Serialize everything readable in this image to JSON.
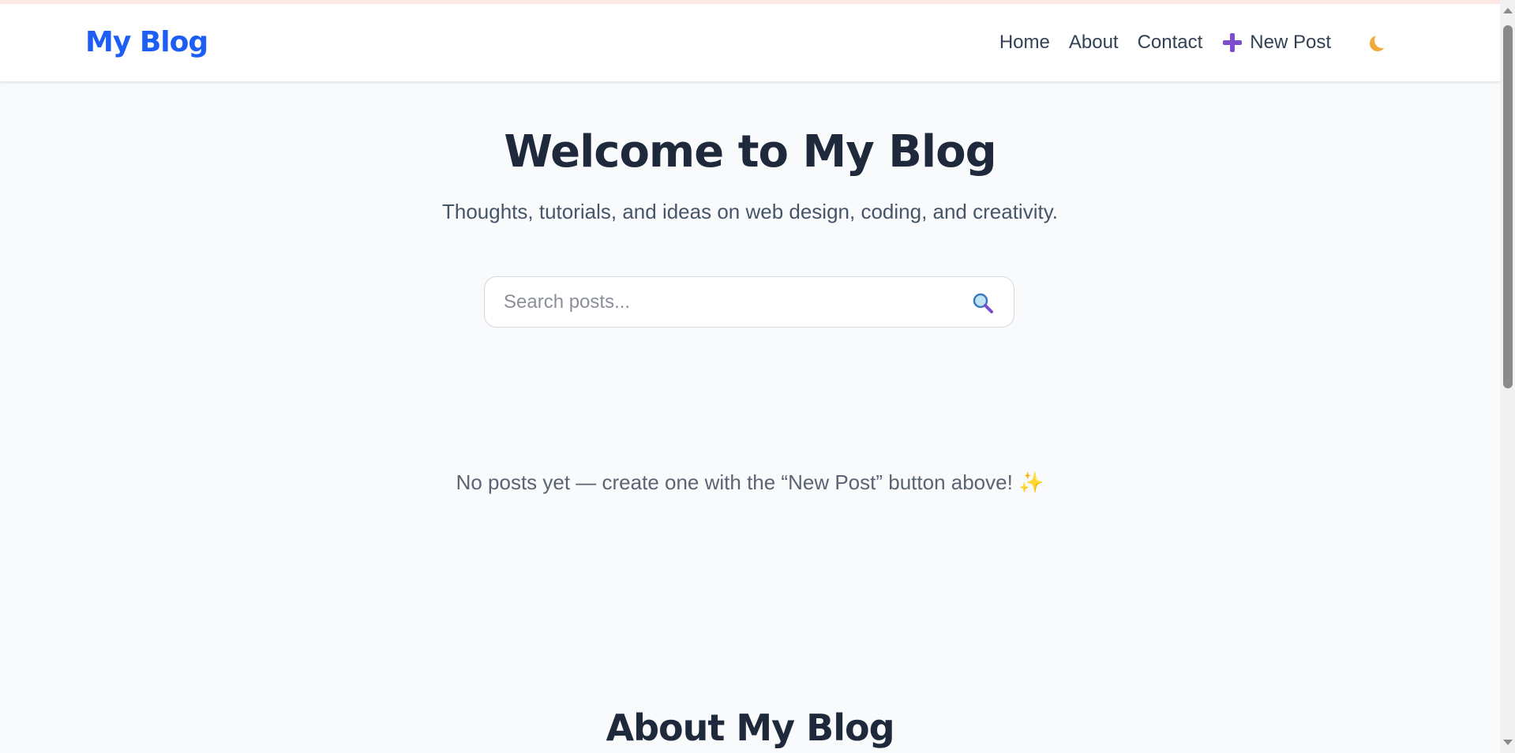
{
  "header": {
    "logo": "My Blog",
    "nav": {
      "home": "Home",
      "about": "About",
      "contact": "Contact",
      "new_post": "New Post"
    },
    "theme_icon": "moon-icon"
  },
  "hero": {
    "title": "Welcome to My Blog",
    "subtitle": "Thoughts, tutorials, and ideas on web design, coding, and creativity."
  },
  "search": {
    "placeholder": "Search posts...",
    "value": "",
    "icon": "search-icon"
  },
  "posts": {
    "empty_message": "No posts yet — create one with the “New Post” button above!",
    "empty_icon": "✨"
  },
  "about": {
    "title": "About My Blog"
  },
  "colors": {
    "brand": "#1d5ef5",
    "text": "#1e293b",
    "background": "#f8fafc",
    "accent_plus": "#7c4dcc"
  }
}
